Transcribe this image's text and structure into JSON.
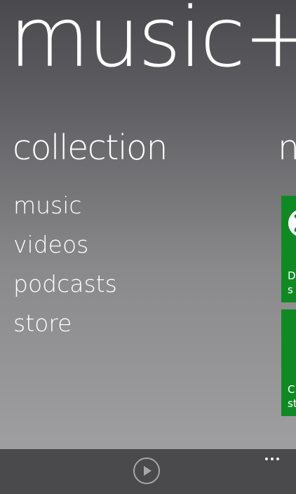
{
  "app": {
    "title": "music+"
  },
  "collection": {
    "heading": "collection",
    "items": [
      {
        "label": "music"
      },
      {
        "label": "videos"
      },
      {
        "label": "podcasts"
      },
      {
        "label": "store"
      }
    ]
  },
  "next_section": {
    "heading_partial": "n"
  },
  "tiles": [
    {
      "icon": "xbox-logo-icon",
      "lines": [
        "D",
        "s"
      ]
    },
    {
      "icon": "",
      "lines": [
        "C",
        "st"
      ]
    }
  ],
  "app_bar": {
    "play_icon": "play-icon",
    "more_icon": "more-options-icon"
  },
  "colors": {
    "tile_green": "#0f8a23",
    "app_bar": "#4a4a4c",
    "text": "#ffffff"
  }
}
